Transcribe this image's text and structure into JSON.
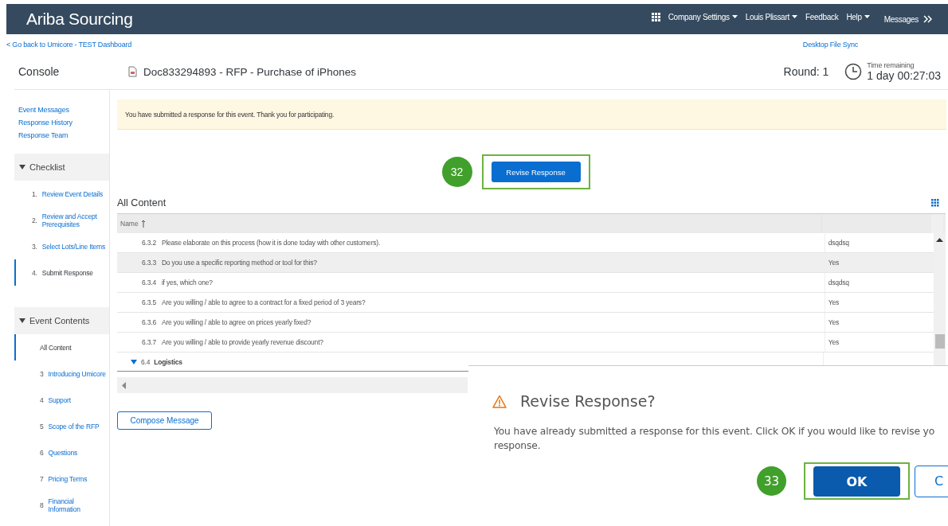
{
  "app_title": "Ariba Sourcing",
  "top_nav": [
    {
      "label": "Company Settings",
      "has_menu": true
    },
    {
      "label": "Louis Plissart",
      "has_menu": true
    },
    {
      "label": "Feedback",
      "has_menu": false
    },
    {
      "label": "Help",
      "has_menu": true
    }
  ],
  "messages_link": "Messages",
  "back_link": "< Go back to Umicore - TEST Dashboard",
  "desktop_sync_link": "Desktop File Sync",
  "console_title": "Console",
  "document_title": "Doc833294893 - RFP - Purchase of iPhones",
  "round": "Round: 1",
  "time_remaining_label": "Time remaining",
  "time_remaining": "1 day 00:27:03",
  "sidebar_links": [
    "Event Messages",
    "Response History",
    "Response Team"
  ],
  "checklist": {
    "title": "Checklist",
    "expanded": true,
    "items": [
      {
        "number": "1.",
        "label": "Review Event Details",
        "selected": false
      },
      {
        "number": "2.",
        "label": "Review and Accept Prerequisites",
        "selected": false
      },
      {
        "number": "3.",
        "label": "Select Lots/Line Items",
        "selected": false
      },
      {
        "number": "4.",
        "label": "Submit Response",
        "selected": true
      }
    ]
  },
  "event_contents": {
    "title": "Event Contents",
    "expanded": true,
    "items": [
      {
        "label": "All Content",
        "selected": true
      },
      {
        "number": "3",
        "label": "Introducing Umicore",
        "selected": false
      },
      {
        "number": "4",
        "label": "Support",
        "selected": false
      },
      {
        "number": "5",
        "label": "Scope of the RFP",
        "selected": false
      },
      {
        "number": "6",
        "label": "Questions",
        "selected": false
      },
      {
        "number": "7",
        "label": "Pricing Terms",
        "selected": false
      },
      {
        "number": "8",
        "label": "Financial Information",
        "selected": false
      }
    ]
  },
  "notice": "You have submitted a response for this event.  Thank you for participating.",
  "revise_button": {
    "label": "Revise Response",
    "step": "32"
  },
  "content_title": "All Content",
  "table": {
    "columns": [
      {
        "label": "Name",
        "sorted": true
      }
    ],
    "rows": [
      {
        "kind": "question",
        "number": "6.3.2",
        "question": "Please elaborate on this process (how it is done today with other customers).",
        "answer": "dsqdsq",
        "highlighted": false
      },
      {
        "kind": "question",
        "number": "6.3.3",
        "question": "Do you use a specific reporting method or tool for this?",
        "answer": "Yes",
        "highlighted": true
      },
      {
        "kind": "question",
        "number": "6.3.4",
        "question": "if yes, which one?",
        "answer": "dsqdsq",
        "highlighted": false
      },
      {
        "kind": "question",
        "number": "6.3.5",
        "question": "Are you willing / able to agree to a contract for a fixed period of 3 years?",
        "answer": "Yes",
        "highlighted": false
      },
      {
        "kind": "question",
        "number": "6.3.6",
        "question": "Are you willing / able to agree on prices yearly fixed?",
        "answer": "Yes",
        "highlighted": false
      },
      {
        "kind": "question",
        "number": "6.3.7",
        "question": "Are you willing / able to provide yearly revenue discount?",
        "answer": "Yes",
        "highlighted": false
      },
      {
        "kind": "group",
        "number": "6.4",
        "question": "Logistics",
        "expanded": true
      }
    ]
  },
  "compose_button": "Compose Message",
  "dialog": {
    "title": "Revise Response?",
    "message_lines": [
      "You have already submitted a response for this event. Click OK if you would like to revise yo",
      "response."
    ],
    "ok_button": "OK",
    "ok_step": "33",
    "cancel_button": "C"
  }
}
